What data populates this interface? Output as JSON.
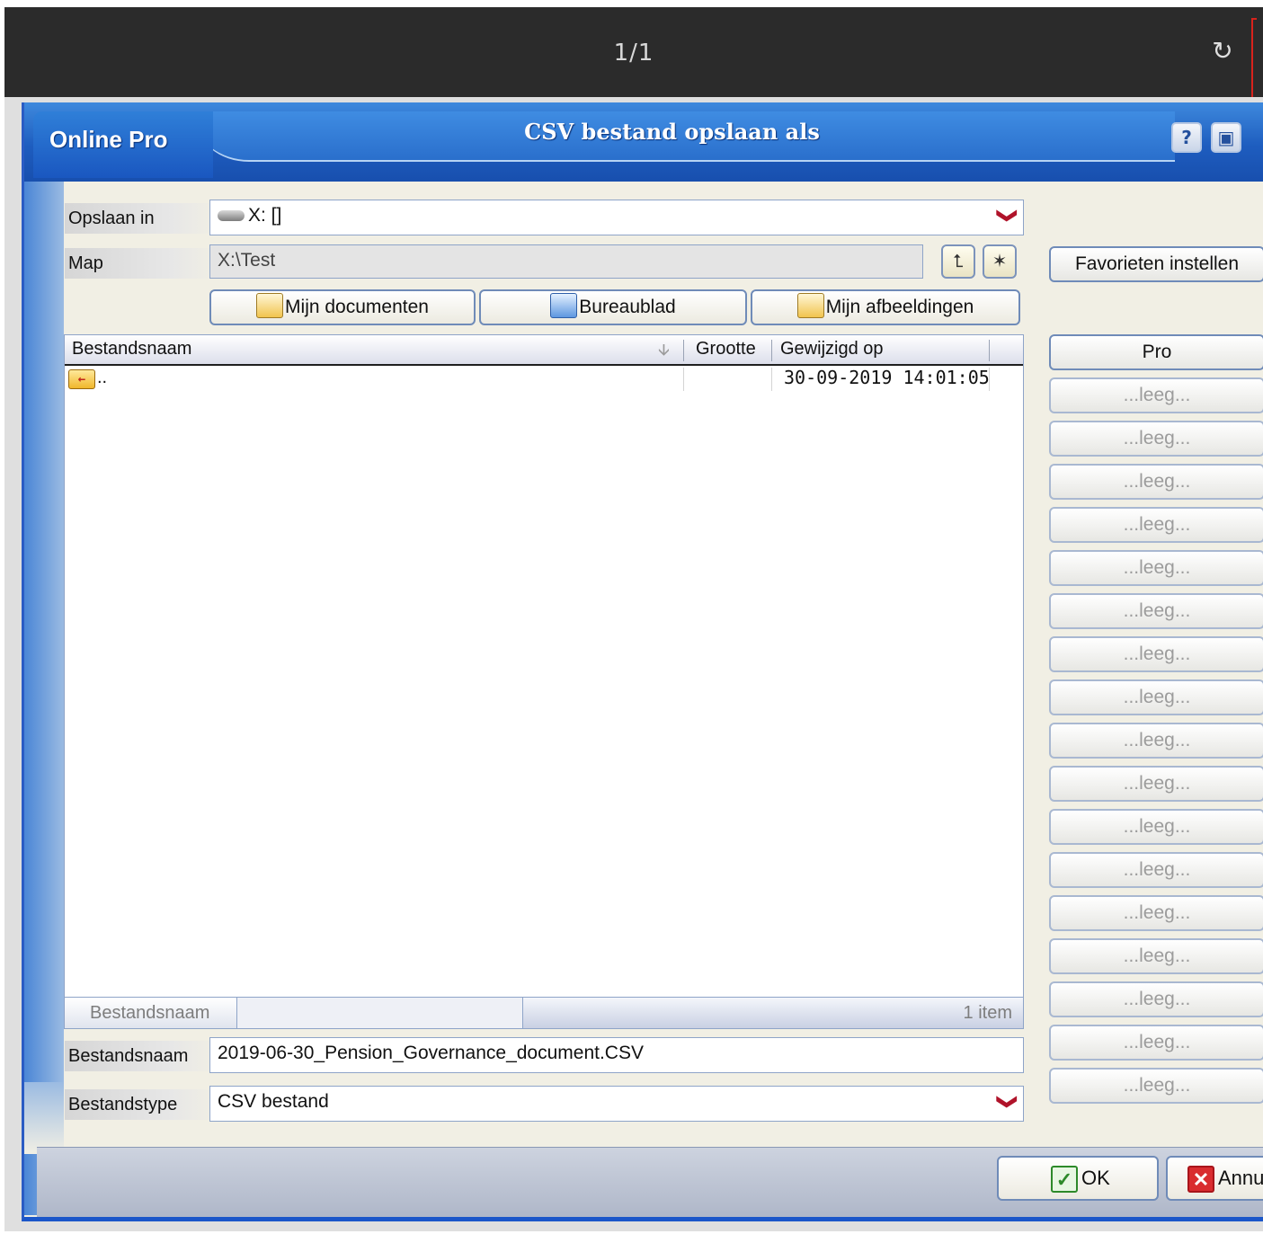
{
  "viewer": {
    "page_indicator": "1/1",
    "rotate_icon": "↻"
  },
  "dialog": {
    "app_name": "Online Pro",
    "title": "CSV bestand opslaan als",
    "help_icon": "?",
    "settings_icon": "▣"
  },
  "form": {
    "save_in_label": "Opslaan in",
    "save_in_value": "X: []",
    "folder_label": "Map",
    "folder_value": "X:\\Test",
    "up_icon": "⮤",
    "newfolder_icon": "✶",
    "dropdown_icon": "❯"
  },
  "quick_nav": [
    {
      "label": "Mijn documenten"
    },
    {
      "label": "Bureaublad"
    },
    {
      "label": "Mijn afbeeldingen"
    }
  ],
  "file_list": {
    "columns": {
      "name": "Bestandsnaam",
      "size": "Grootte",
      "modified": "Gewijzigd op"
    },
    "sort_icon": "🡫",
    "rows": [
      {
        "name": "..",
        "size": "",
        "modified": "30-09-2019 14:01:05"
      }
    ],
    "status_label": "Bestandsnaam",
    "status_count": "1 item"
  },
  "filename": {
    "label": "Bestandsnaam",
    "value": "2019-06-30_Pension_Governance_document.CSV"
  },
  "filetype": {
    "label": "Bestandstype",
    "value": "CSV bestand"
  },
  "favorites": {
    "settings_button": "Favorieten instellen",
    "items": [
      "Pro",
      "...leeg...",
      "...leeg...",
      "...leeg...",
      "...leeg...",
      "...leeg...",
      "...leeg...",
      "...leeg...",
      "...leeg...",
      "...leeg...",
      "...leeg...",
      "...leeg...",
      "...leeg...",
      "...leeg...",
      "...leeg...",
      "...leeg...",
      "...leeg...",
      "...leeg..."
    ]
  },
  "actions": {
    "ok_label": "OK",
    "ok_icon": "✓",
    "cancel_label": "Annuleren",
    "cancel_icon": "✕"
  }
}
